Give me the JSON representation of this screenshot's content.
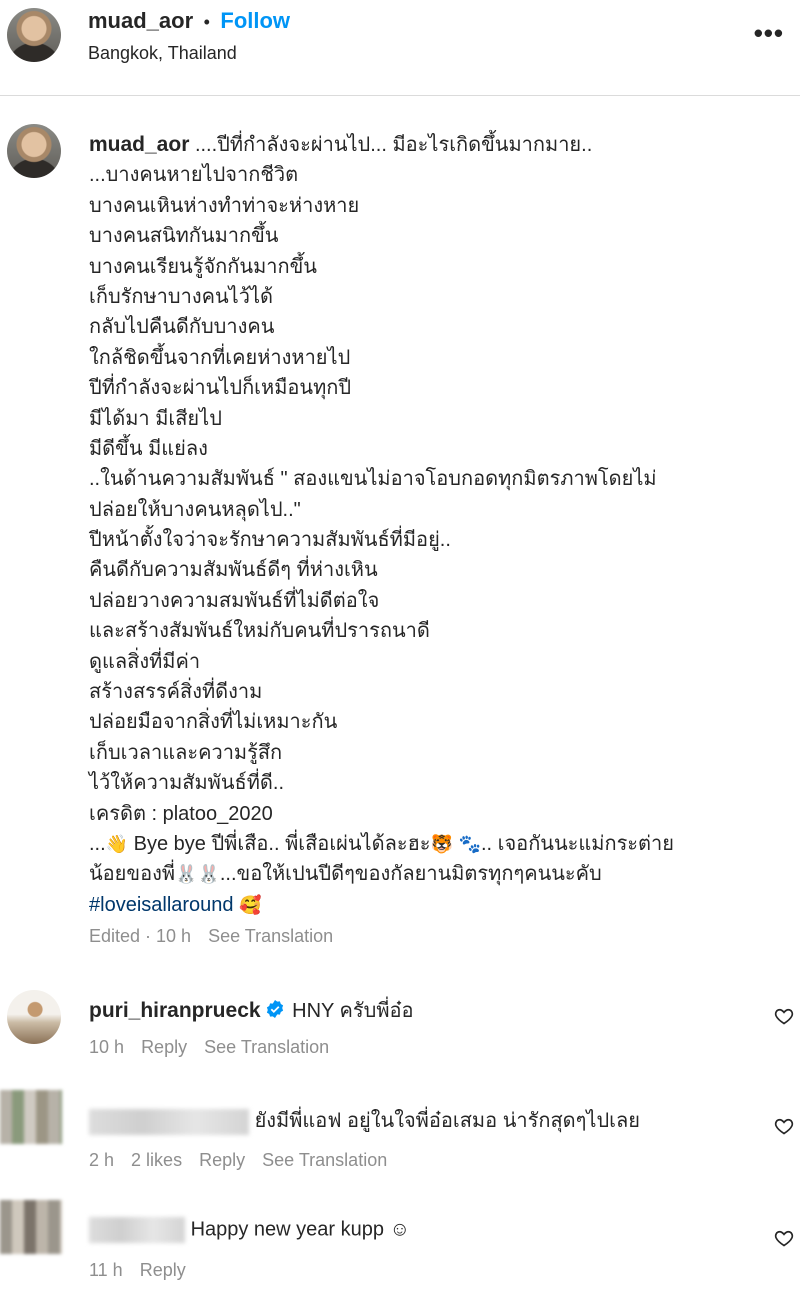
{
  "post": {
    "author": "muad_aor",
    "separator": "•",
    "follow_label": "Follow",
    "location": "Bangkok, Thailand",
    "more_label": "•••"
  },
  "caption": {
    "author": "muad_aor",
    "first_line": "....ปีที่กำลังจะผ่านไป... มีอะไรเกิดขึ้นมากมาย..",
    "lines": [
      "...บางคนหายไปจากชีวิต",
      "บางคนเหินห่างทำท่าจะห่างหาย",
      "บางคนสนิทกันมากขึ้น",
      "บางคนเรียนรู้จักกันมากขึ้น",
      "เก็บรักษาบางคนไว้ได้",
      "กลับไปคืนดีกับบางคน",
      "ใกล้ชิดขึ้นจากที่เคยห่างหายไป",
      "ปีที่กำลังจะผ่านไปก็เหมือนทุกปี",
      "มีได้มา มีเสียไป",
      "มีดีขึ้น มีแย่ลง",
      "..ในด้านความสัมพันธ์ \" สองแขนไม่อาจโอบกอดทุกมิตรภาพโดยไม่",
      "ปล่อยให้บางคนหลุดไป..\"",
      "ปีหน้าตั้งใจว่าจะรักษาความสัมพันธ์ที่มีอยู่..",
      "คืนดีกับความสัมพันธ์ดีๆ ที่ห่างเหิน",
      "ปล่อยวางความสมพันธ์ที่ไม่ดีต่อใจ",
      "และสร้างสัมพันธ์ใหม่กับคนที่ปรารถนาดี",
      "ดูแลสิ่งที่มีค่า",
      "สร้างสรรค์สิ่งที่ดีงาม",
      "ปล่อยมือจากสิ่งที่ไม่เหมาะกัน",
      "เก็บเวลาและความรู้สึก",
      "ไว้ให้ความสัมพันธ์ที่ดี..",
      "เครดิต : platoo_2020"
    ],
    "line_bye_1": "...",
    "line_bye_2": " Bye bye ปีพี่เสือ.. พี่เสือเผ่นได้ละฮะ",
    "line_bye_3": ".. เจอกันนะแม่กระต่าย",
    "line_last_1": "น้อยของพี่",
    "line_last_2": "...ขอให้เปนปีดีๆของกัลยานมิตรทุกๆคนนะคับ",
    "hashtag": "#loveisallaround",
    "emoji_wave": "👋",
    "emoji_tiger": "🐯",
    "emoji_paws": "🐾",
    "emoji_rabbits": "🐰🐰",
    "emoji_smile": "🥰",
    "meta_edited": "Edited · 10 h",
    "meta_translate": "See Translation"
  },
  "comments": [
    {
      "username": "puri_hiranprueck",
      "verified_icon": "verified-badge-icon",
      "text": "HNY ครับพี่อ๋อ",
      "time": "10 h",
      "reply": "Reply",
      "translate": "See Translation"
    },
    {
      "username": "",
      "text": "ยังมีพี่แอฟ อยู่ในใจพี่อ๋อเสมอ น่ารักสุดๆไปเลย",
      "time": "2 h",
      "likes": "2 likes",
      "reply": "Reply",
      "translate": "See Translation"
    },
    {
      "username": "",
      "text": "Happy new year kupp ☺",
      "time": "11 h",
      "reply": "Reply"
    }
  ],
  "colors": {
    "link_blue": "#0095f6",
    "hashtag": "#00376b",
    "secondary_text": "#8e8e8e",
    "verified": "#0095f6"
  }
}
